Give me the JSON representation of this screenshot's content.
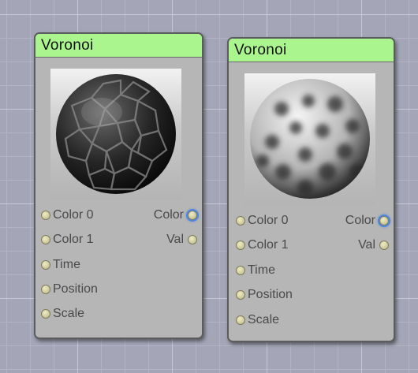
{
  "nodes": [
    {
      "title": "Voronoi",
      "preview": "dark-voronoi-cells",
      "inputs": [
        "Color 0",
        "Color 1",
        "Time",
        "Position",
        "Scale"
      ],
      "outputs": [
        "Color",
        "Val"
      ]
    },
    {
      "title": "Voronoi",
      "preview": "light-voronoi-spots",
      "inputs": [
        "Color 0",
        "Color 1",
        "Time",
        "Position",
        "Scale"
      ],
      "outputs": [
        "Color",
        "Val"
      ]
    }
  ],
  "colors": {
    "header": "#abf58f",
    "node_body": "#b6b6b6",
    "socket": "#c9c596",
    "active_socket_ring": "#4d86e0",
    "canvas": "#a4a6b8"
  }
}
